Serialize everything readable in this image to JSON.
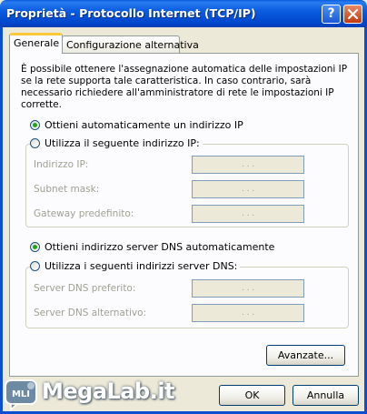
{
  "window": {
    "title": "Proprietà - Protocollo Internet (TCP/IP)",
    "help_label": "?",
    "colors": {
      "titlebar": "#0a5ce0",
      "face": "#ece9d8",
      "radio_dot": "#21a121",
      "tab_highlight": "#ffc83c"
    }
  },
  "tabs": [
    {
      "label": "Generale",
      "active": true
    },
    {
      "label": "Configurazione alternativa",
      "active": false
    }
  ],
  "intro": "È possibile ottenere l'assegnazione automatica delle impostazioni IP se la rete supporta tale caratteristica. In caso contrario, sarà necessario richiedere all'amministratore di rete le impostazioni IP corrette.",
  "ip": {
    "auto_label": "Ottieni automaticamente un indirizzo IP",
    "auto_checked": true,
    "manual_label": "Utilizza il seguente indirizzo IP:",
    "manual_checked": false,
    "fields": [
      {
        "label": "Indirizzo IP:",
        "value": ". . ."
      },
      {
        "label": "Subnet mask:",
        "value": ". . ."
      },
      {
        "label": "Gateway predefinito:",
        "value": ". . ."
      }
    ]
  },
  "dns": {
    "auto_label": "Ottieni indirizzo server DNS automaticamente",
    "auto_checked": true,
    "manual_label": "Utilizza i seguenti indirizzi server DNS:",
    "manual_checked": false,
    "fields": [
      {
        "label": "Server DNS preferito:",
        "value": ". . ."
      },
      {
        "label": "Server DNS alternativo:",
        "value": ". . ."
      }
    ]
  },
  "buttons": {
    "advanced": "Avanzate...",
    "ok": "OK",
    "cancel": "Annulla"
  },
  "watermark": {
    "text": "MegaLab.it",
    "logo_text": "MLI"
  }
}
